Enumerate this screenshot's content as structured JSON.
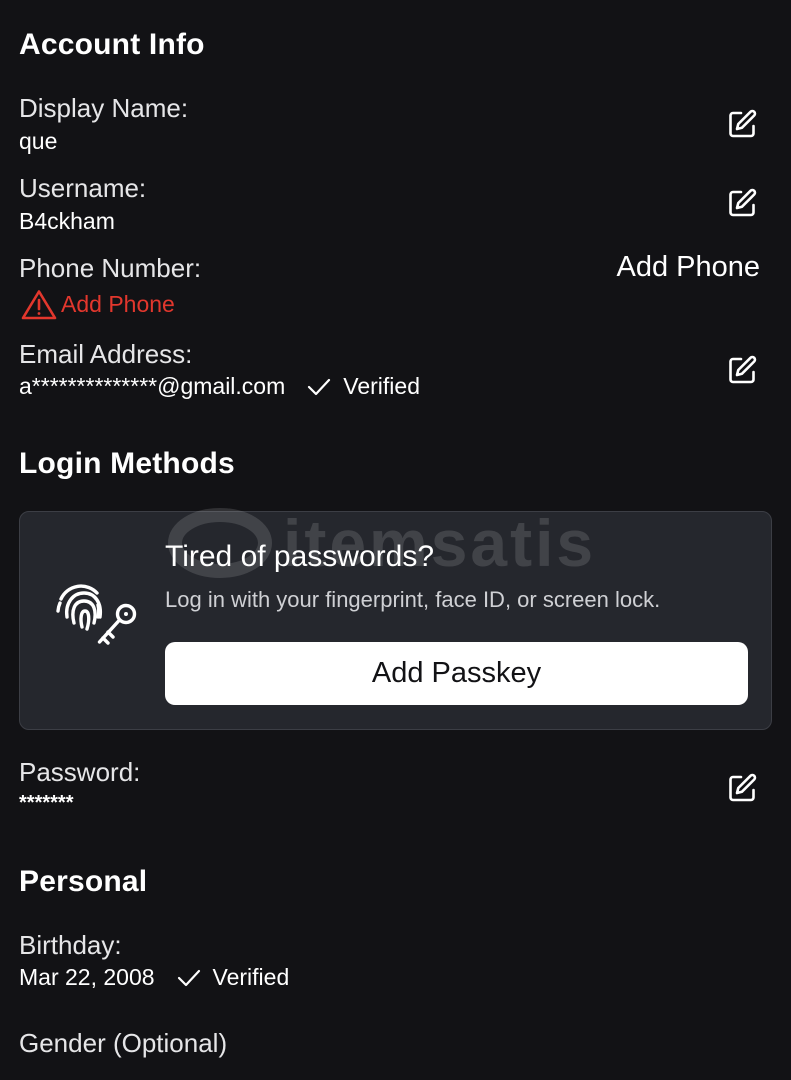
{
  "account_info": {
    "title": "Account Info",
    "display_name": {
      "label": "Display Name:",
      "value": "que"
    },
    "username": {
      "label": "Username:",
      "value": "B4ckham"
    },
    "phone": {
      "label": "Phone Number:",
      "warning": "Add Phone",
      "action": "Add Phone"
    },
    "email": {
      "label": "Email Address:",
      "value": "a**************@gmail.com",
      "status": "Verified"
    }
  },
  "login_methods": {
    "title": "Login Methods",
    "passkey": {
      "title": "Tired of passwords?",
      "description": "Log in with your fingerprint, face ID, or screen lock.",
      "button": "Add Passkey"
    },
    "password": {
      "label": "Password:",
      "value": "*******"
    }
  },
  "personal": {
    "title": "Personal",
    "birthday": {
      "label": "Birthday:",
      "value": "Mar 22, 2008",
      "status": "Verified"
    },
    "gender": {
      "label": "Gender (Optional)"
    }
  },
  "watermark": {
    "brand": "itemsatis"
  },
  "colors": {
    "background": "#121215",
    "card": "#25272d",
    "warning": "#e2372d",
    "text": "#ffffff"
  },
  "icons": [
    "edit-icon",
    "warning-icon",
    "check-icon",
    "fingerprint-key-icon"
  ]
}
